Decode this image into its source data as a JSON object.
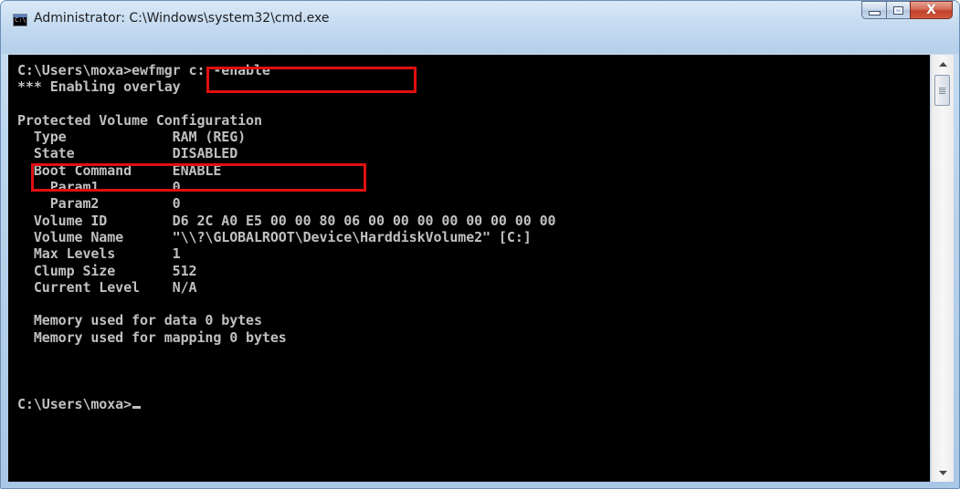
{
  "window": {
    "title": "Administrator: C:\\Windows\\system32\\cmd.exe",
    "icon": "cmd-icon",
    "icon_text": "C:\\",
    "buttons": {
      "minimize": "minimize-icon",
      "maximize": "maximize-icon",
      "close_label": "X"
    }
  },
  "console": {
    "foreground": "#c0c0c0",
    "background": "#000000",
    "highlight_color": "#e01010",
    "lines": [
      "C:\\Users\\moxa>ewfmgr c: -enable",
      "*** Enabling overlay",
      "",
      "Protected Volume Configuration",
      "  Type             RAM (REG)",
      "  State            DISABLED",
      "  Boot Command     ENABLE",
      "    Param1         0",
      "    Param2         0",
      "  Volume ID        D6 2C A0 E5 00 00 80 06 00 00 00 00 00 00 00 00",
      "  Volume Name      \"\\\\?\\GLOBALROOT\\Device\\HarddiskVolume2\" [C:]",
      "  Max Levels       1",
      "  Clump Size       512",
      "  Current Level    N/A",
      "",
      "  Memory used for data 0 bytes",
      "  Memory used for mapping 0 bytes",
      "",
      "",
      "",
      "C:\\Users\\moxa>"
    ]
  },
  "scrollbar": {
    "up": "scroll-up-arrow-icon",
    "down": "scroll-down-arrow-icon"
  }
}
